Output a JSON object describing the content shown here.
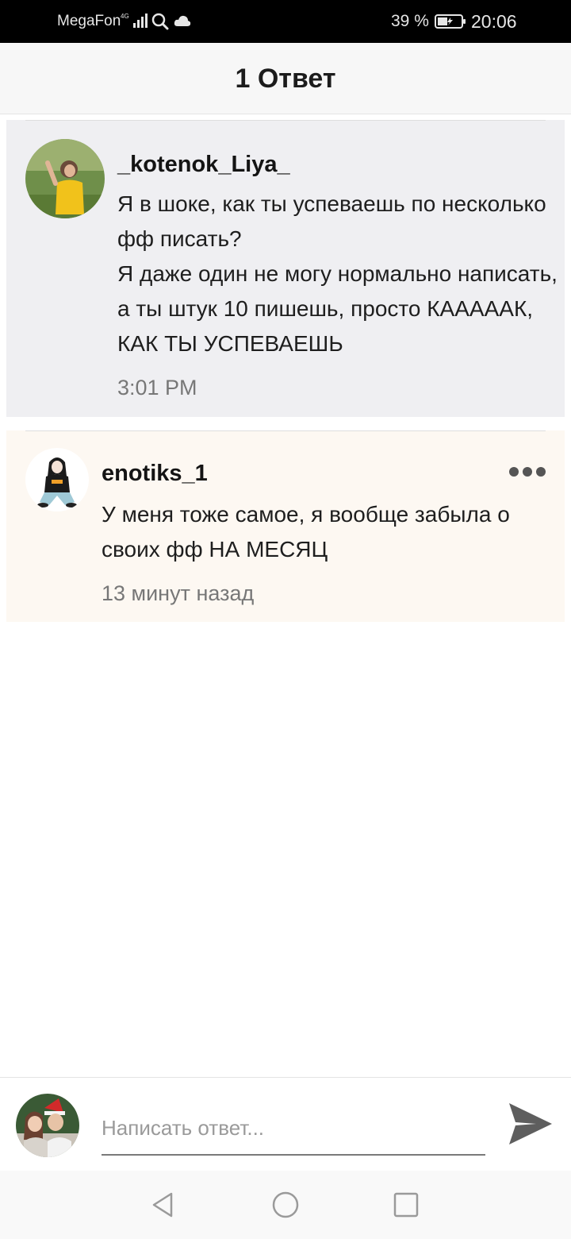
{
  "status_bar": {
    "carrier": "MegaFon",
    "network": "4G",
    "battery_percent": "39 %",
    "time": "20:06"
  },
  "header": {
    "title": "1 Ответ"
  },
  "original_comment": {
    "username": "_kotenok_Liya_",
    "text": "Я в шоке, как ты успеваешь по несколько фф писать?\nЯ даже один не могу нормально написать, а ты штук 10 пишешь, просто КАААААК, КАК ТЫ УСПЕВАЕШЬ",
    "time": "3:01 PM"
  },
  "reply_comment": {
    "username": "enotiks_1",
    "text": "У меня тоже самое, я вообще забыла о своих фф НА МЕСЯЦ",
    "time": "13 минут назад"
  },
  "composer": {
    "placeholder": "Написать ответ..."
  },
  "icons": {
    "more": "more-dots-icon",
    "send": "send-icon",
    "back": "back-triangle-icon",
    "home": "home-circle-icon",
    "recents": "recents-square-icon"
  },
  "colors": {
    "original_card_bg": "#efeff2",
    "reply_card_bg": "#fdf8f2",
    "status_bar_bg": "#000000"
  }
}
